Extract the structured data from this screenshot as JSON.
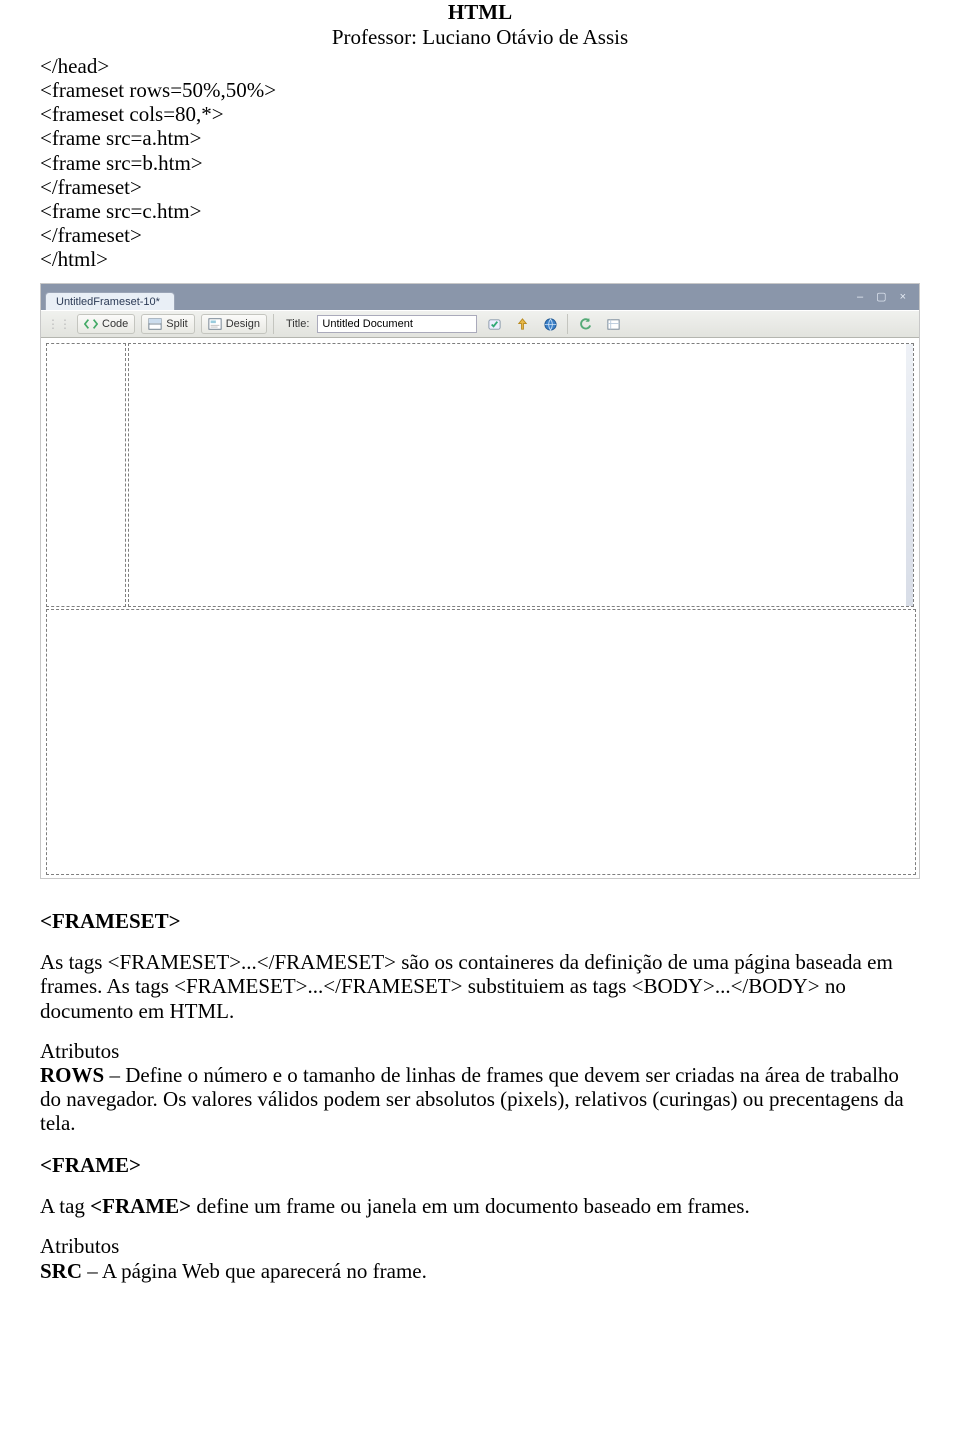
{
  "header": {
    "title": "HTML",
    "subtitle": "Professor: Luciano Otávio de Assis"
  },
  "code": {
    "lines": [
      "</head>",
      "<frameset rows=50%,50%>",
      "<frameset cols=80,*>",
      "<frame src=a.htm>",
      "<frame src=b.htm>",
      "</frameset>",
      "<frame src=c.htm>",
      "</frameset>",
      "</html>"
    ]
  },
  "editor": {
    "tab_label": "UntitledFrameset-10*",
    "winbtns": "–  ▢  ×",
    "toolbar": {
      "code": "Code",
      "split": "Split",
      "design": "Design",
      "title_label": "Title:",
      "title_value": "Untitled Document",
      "icons": {
        "code": "code-icon",
        "split": "split-icon",
        "design": "design-icon",
        "check": "check-markup-icon",
        "upload": "upload-icon",
        "globe": "globe-icon",
        "refresh": "refresh-icon",
        "options": "view-options-icon"
      }
    }
  },
  "body_text": {
    "frameset_heading": "<FRAMESET>",
    "frameset_p1": "As tags <FRAMESET>...</FRAMESET> são os containeres da definição de uma página baseada em frames. As tags  <FRAMESET>...</FRAMESET> substituiem as tags <BODY>...</BODY> no documento em HTML.",
    "atributos_label": "Atributos",
    "rows_label": "ROWS",
    "rows_text": " – Define o número e o tamanho de linhas de frames que devem ser criadas na área de trabalho do navegador. Os valores válidos  podem ser absolutos (pixels), relativos (curingas) ou precentagens da tela.",
    "frame_heading": "<FRAME>",
    "frame_p1_a": "A tag ",
    "frame_p1_b": "<FRAME>",
    "frame_p1_c": " define um frame ou janela em um documento baseado em frames.",
    "atributos_label2": "Atributos",
    "src_label": "SRC",
    "src_text": " – A página Web que aparecerá no frame."
  }
}
